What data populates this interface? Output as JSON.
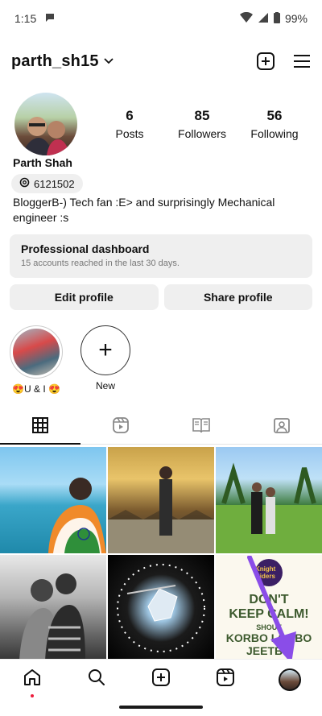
{
  "status_bar": {
    "time": "1:15",
    "battery": "99%"
  },
  "header": {
    "username": "parth_sh15",
    "icons": [
      "chevron-down-icon",
      "add-post-icon",
      "menu-icon"
    ]
  },
  "profile": {
    "stats": [
      {
        "value": "6",
        "label": "Posts"
      },
      {
        "value": "85",
        "label": "Followers"
      },
      {
        "value": "56",
        "label": "Following"
      }
    ],
    "display_name": "Parth Shah",
    "threads_handle": "6121502",
    "bio": "BloggerB-) Tech fan :E> and surprisingly Mechanical engineer :s"
  },
  "dashboard": {
    "title": "Professional dashboard",
    "subtitle": "15 accounts reached in the last 30 days."
  },
  "buttons": {
    "edit": "Edit profile",
    "share": "Share profile"
  },
  "highlights": [
    {
      "label": "😍U & I 😍"
    },
    {
      "label": "New"
    }
  ],
  "tabs": [
    "posts-grid",
    "reels",
    "guides",
    "tagged"
  ],
  "grid_post_text": {
    "badge": "Knight Riders",
    "line1": "DON'T",
    "line2": "KEEP CALM!",
    "small": "SHOUT",
    "line3": "KORBO LORBO",
    "line4": "JEETBO"
  },
  "bottom_nav": [
    "home-icon",
    "search-icon",
    "create-icon",
    "reels-icon",
    "profile-avatar"
  ],
  "colors": {
    "accent_arrow": "#8a4de8",
    "notification_dot": "#ed1c3c",
    "surface": "#efefef"
  }
}
